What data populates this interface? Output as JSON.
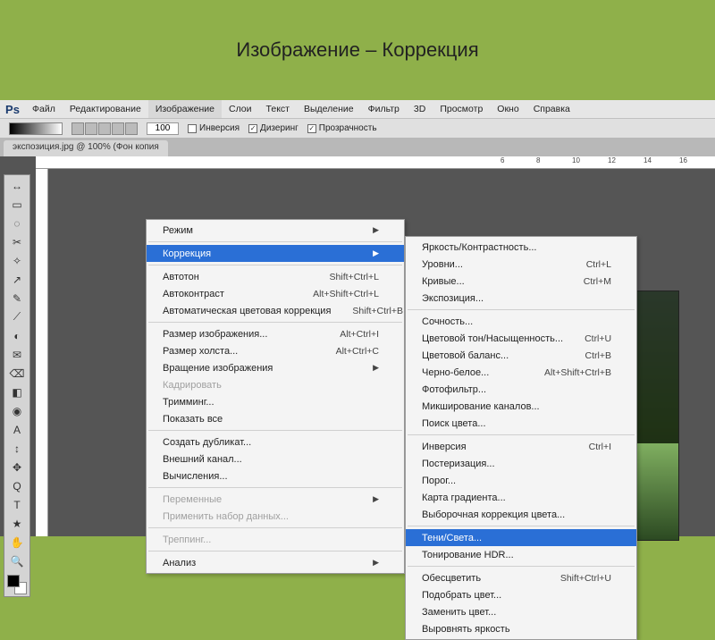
{
  "title": "Изображение – Коррекция",
  "menubar": [
    "Файл",
    "Редактирование",
    "Изображение",
    "Слои",
    "Текст",
    "Выделение",
    "Фильтр",
    "3D",
    "Просмотр",
    "Окно",
    "Справка"
  ],
  "open_menu_index": 2,
  "options": {
    "num": "100",
    "inverse": "Инверсия",
    "dither": "Дизеринг",
    "transp": "Прозрачность"
  },
  "doc_tab": "экспозиция.jpg @ 100% (Фон копия",
  "ruler_ticks": [
    "6",
    "8",
    "10",
    "12",
    "14",
    "16"
  ],
  "tools": [
    "↔",
    "▭",
    "◌",
    "✂",
    "✧",
    "↗",
    "✎",
    "⟋",
    "◐",
    "✉",
    "⌫",
    "◧",
    "◉",
    "A",
    "↕",
    "✥",
    "Q",
    "T",
    "★",
    "✋",
    "🔍"
  ],
  "menu_image": [
    {
      "t": "item",
      "label": "Режим",
      "sub": true
    },
    {
      "t": "sep"
    },
    {
      "t": "item",
      "label": "Коррекция",
      "sub": true,
      "hl": true
    },
    {
      "t": "sep"
    },
    {
      "t": "item",
      "label": "Автотон",
      "sc": "Shift+Ctrl+L"
    },
    {
      "t": "item",
      "label": "Автоконтраст",
      "sc": "Alt+Shift+Ctrl+L"
    },
    {
      "t": "item",
      "label": "Автоматическая цветовая коррекция",
      "sc": "Shift+Ctrl+B"
    },
    {
      "t": "sep"
    },
    {
      "t": "item",
      "label": "Размер изображения...",
      "sc": "Alt+Ctrl+I"
    },
    {
      "t": "item",
      "label": "Размер холста...",
      "sc": "Alt+Ctrl+C"
    },
    {
      "t": "item",
      "label": "Вращение изображения",
      "sub": true
    },
    {
      "t": "item",
      "label": "Кадрировать",
      "dis": true
    },
    {
      "t": "item",
      "label": "Тримминг..."
    },
    {
      "t": "item",
      "label": "Показать все"
    },
    {
      "t": "sep"
    },
    {
      "t": "item",
      "label": "Создать дубликат..."
    },
    {
      "t": "item",
      "label": "Внешний канал..."
    },
    {
      "t": "item",
      "label": "Вычисления..."
    },
    {
      "t": "sep"
    },
    {
      "t": "item",
      "label": "Переменные",
      "sub": true,
      "dis": true
    },
    {
      "t": "item",
      "label": "Применить набор данных...",
      "dis": true
    },
    {
      "t": "sep"
    },
    {
      "t": "item",
      "label": "Треппинг...",
      "dis": true
    },
    {
      "t": "sep"
    },
    {
      "t": "item",
      "label": "Анализ",
      "sub": true
    }
  ],
  "menu_corr": [
    {
      "t": "item",
      "label": "Яркость/Контрастность..."
    },
    {
      "t": "item",
      "label": "Уровни...",
      "sc": "Ctrl+L"
    },
    {
      "t": "item",
      "label": "Кривые...",
      "sc": "Ctrl+M"
    },
    {
      "t": "item",
      "label": "Экспозиция..."
    },
    {
      "t": "sep"
    },
    {
      "t": "item",
      "label": "Сочность..."
    },
    {
      "t": "item",
      "label": "Цветовой тон/Насыщенность...",
      "sc": "Ctrl+U"
    },
    {
      "t": "item",
      "label": "Цветовой баланс...",
      "sc": "Ctrl+B"
    },
    {
      "t": "item",
      "label": "Черно-белое...",
      "sc": "Alt+Shift+Ctrl+B"
    },
    {
      "t": "item",
      "label": "Фотофильтр..."
    },
    {
      "t": "item",
      "label": "Микширование каналов..."
    },
    {
      "t": "item",
      "label": "Поиск цвета..."
    },
    {
      "t": "sep"
    },
    {
      "t": "item",
      "label": "Инверсия",
      "sc": "Ctrl+I"
    },
    {
      "t": "item",
      "label": "Постеризация..."
    },
    {
      "t": "item",
      "label": "Порог..."
    },
    {
      "t": "item",
      "label": "Карта градиента..."
    },
    {
      "t": "item",
      "label": "Выборочная коррекция цвета..."
    },
    {
      "t": "sep"
    },
    {
      "t": "item",
      "label": "Тени/Света...",
      "hl": true
    },
    {
      "t": "item",
      "label": "Тонирование HDR..."
    },
    {
      "t": "sep"
    },
    {
      "t": "item",
      "label": "Обесцветить",
      "sc": "Shift+Ctrl+U"
    },
    {
      "t": "item",
      "label": "Подобрать цвет..."
    },
    {
      "t": "item",
      "label": "Заменить цвет..."
    },
    {
      "t": "item",
      "label": "Выровнять яркость"
    }
  ]
}
